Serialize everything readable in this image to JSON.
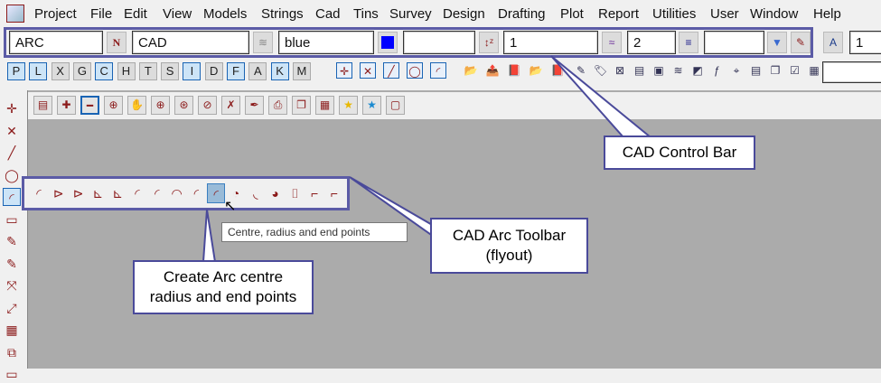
{
  "menu": [
    "Project",
    "File",
    "Edit",
    "View",
    "Models",
    "Strings",
    "Cad",
    "Tins",
    "Survey",
    "Design",
    "Drafting",
    "Plot",
    "Report",
    "Utilities",
    "User",
    "Window",
    "Help"
  ],
  "control_bar": {
    "name": "ARC",
    "model": "CAD",
    "colour": "blue",
    "colour_hex": "#0000ff",
    "height": "",
    "style": "1",
    "weight": "2",
    "extra": ""
  },
  "text_size": "1",
  "snap_buttons": [
    "P",
    "L",
    "X",
    "G",
    "C",
    "H",
    "T",
    "S",
    "I",
    "D",
    "F",
    "A",
    "K",
    "M"
  ],
  "snap_active": [
    true,
    true,
    false,
    false,
    true,
    false,
    false,
    false,
    true,
    false,
    true,
    false,
    true,
    false
  ],
  "tooltip": "Centre, radius and end points",
  "callouts": {
    "control_bar": "CAD Control Bar",
    "arc_toolbar": "CAD Arc Toolbar\n(flyout)",
    "arc_toolbar_l1": "CAD Arc Toolbar",
    "arc_toolbar_l2": "(flyout)",
    "create_l1": "Create Arc centre",
    "create_l2": "radius and end points"
  },
  "colors": {
    "accent": "#5b5ba6",
    "canvas": "#ababab"
  }
}
